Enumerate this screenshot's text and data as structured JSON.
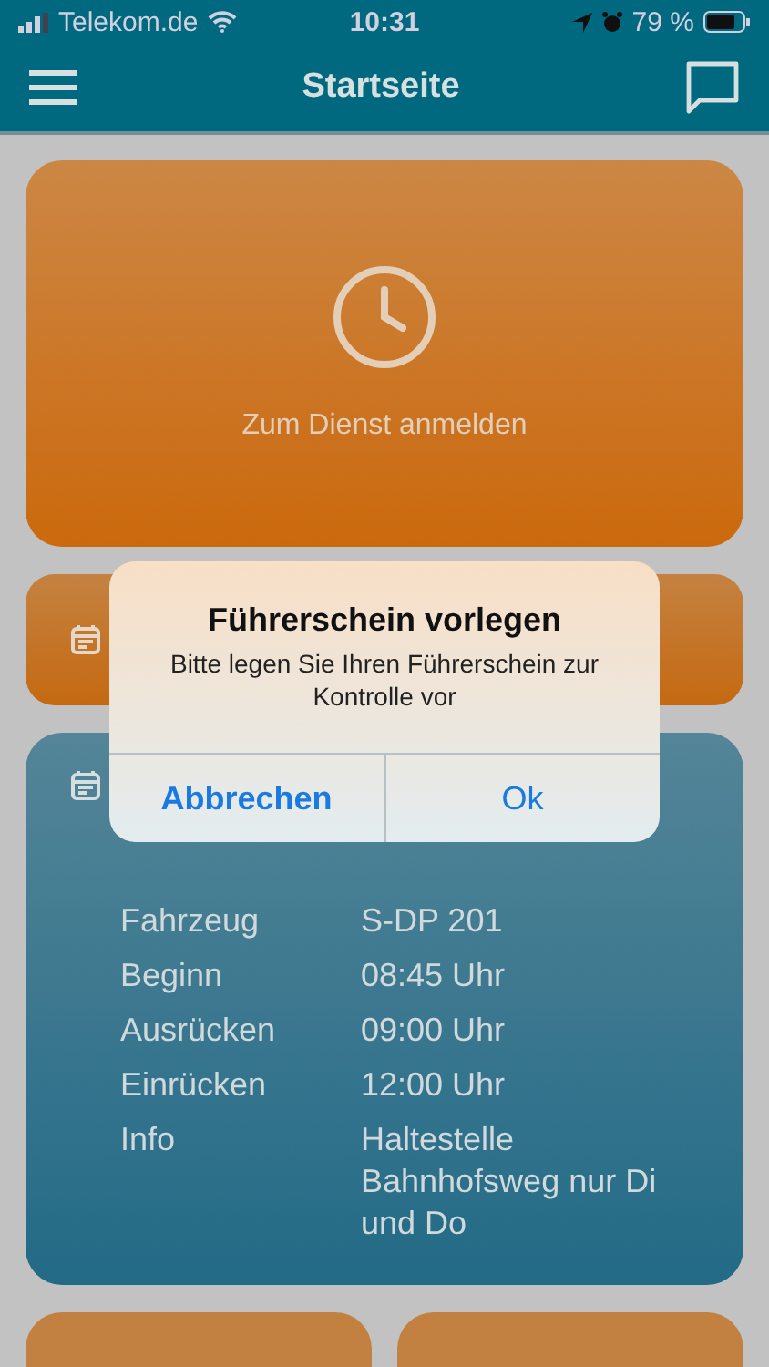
{
  "status_bar": {
    "carrier": "Telekom.de",
    "time": "10:31",
    "battery": "79 %"
  },
  "header": {
    "title": "Startseite"
  },
  "sign_in_card": {
    "label": "Zum Dienst anmelden"
  },
  "duty_details": [
    {
      "label": "Fahrzeug",
      "value": "S-DP 201"
    },
    {
      "label": "Beginn",
      "value": "08:45 Uhr"
    },
    {
      "label": "Ausrücken",
      "value": "09:00 Uhr"
    },
    {
      "label": "Einrücken",
      "value": "12:00 Uhr"
    },
    {
      "label": "Info",
      "value": "Haltestelle Bahnhofsweg nur Di und Do"
    }
  ],
  "dialog": {
    "title": "Führerschein vorlegen",
    "message": "Bitte legen Sie Ihren Führerschein zur Kontrolle vor",
    "buttons": [
      {
        "label": "Abbrechen",
        "kind": "cancel"
      },
      {
        "label": "Ok",
        "kind": "default"
      }
    ]
  }
}
